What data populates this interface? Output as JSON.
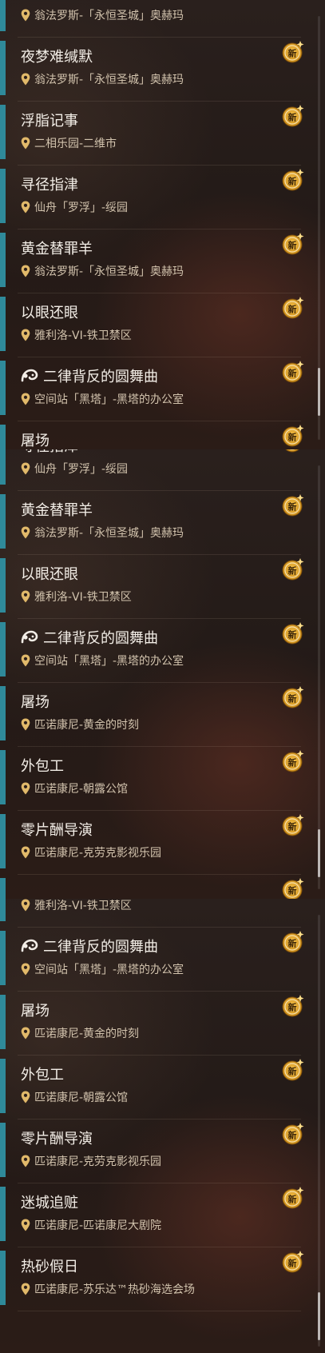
{
  "new_badge_label": "新",
  "colors": {
    "accent": "#2f8a9a",
    "gold": "#e8b13c",
    "title": "#f3eee7",
    "location": "#d2c3ad"
  },
  "panels": [
    {
      "items": [
        {
          "title": "",
          "location": "翁法罗斯-「永恒圣城」奥赫玛",
          "icon": ""
        },
        {
          "title": "夜梦难缄默",
          "location": "翁法罗斯-「永恒圣城」奥赫玛",
          "icon": ""
        },
        {
          "title": "浮脂记事",
          "location": "二相乐园-二维市",
          "icon": ""
        },
        {
          "title": "寻径指津",
          "location": "仙舟「罗浮」-绥园",
          "icon": ""
        },
        {
          "title": "黄金替罪羊",
          "location": "翁法罗斯-「永恒圣城」奥赫玛",
          "icon": ""
        },
        {
          "title": "以眼还眼",
          "location": "雅利洛-VI-铁卫禁区",
          "icon": ""
        },
        {
          "title": "二律背反的圆舞曲",
          "location": "空间站「黑塔」-黑塔的办公室",
          "icon": "quest-icon"
        },
        {
          "title": "屠场",
          "location": "",
          "icon": ""
        }
      ]
    },
    {
      "items": [
        {
          "title": "寻径指津",
          "location": "仙舟「罗浮」-绥园",
          "icon": ""
        },
        {
          "title": "黄金替罪羊",
          "location": "翁法罗斯-「永恒圣城」奥赫玛",
          "icon": ""
        },
        {
          "title": "以眼还眼",
          "location": "雅利洛-VI-铁卫禁区",
          "icon": ""
        },
        {
          "title": "二律背反的圆舞曲",
          "location": "空间站「黑塔」-黑塔的办公室",
          "icon": "quest-icon"
        },
        {
          "title": "屠场",
          "location": "匹诺康尼-黄金的时刻",
          "icon": ""
        },
        {
          "title": "外包工",
          "location": "匹诺康尼-朝露公馆",
          "icon": ""
        },
        {
          "title": "零片酬导演",
          "location": "匹诺康尼-克劳克影视乐园",
          "icon": ""
        },
        {
          "title": "",
          "location": "",
          "icon": ""
        }
      ]
    },
    {
      "items": [
        {
          "title": "",
          "location": "雅利洛-VI-铁卫禁区",
          "icon": ""
        },
        {
          "title": "二律背反的圆舞曲",
          "location": "空间站「黑塔」-黑塔的办公室",
          "icon": "quest-icon"
        },
        {
          "title": "屠场",
          "location": "匹诺康尼-黄金的时刻",
          "icon": ""
        },
        {
          "title": "外包工",
          "location": "匹诺康尼-朝露公馆",
          "icon": ""
        },
        {
          "title": "零片酬导演",
          "location": "匹诺康尼-克劳克影视乐园",
          "icon": ""
        },
        {
          "title": "迷城追赃",
          "location": "匹诺康尼-匹诺康尼大剧院",
          "icon": ""
        },
        {
          "title": "热砂假日",
          "location": "匹诺康尼-苏乐达™热砂海选会场",
          "icon": ""
        }
      ]
    }
  ]
}
